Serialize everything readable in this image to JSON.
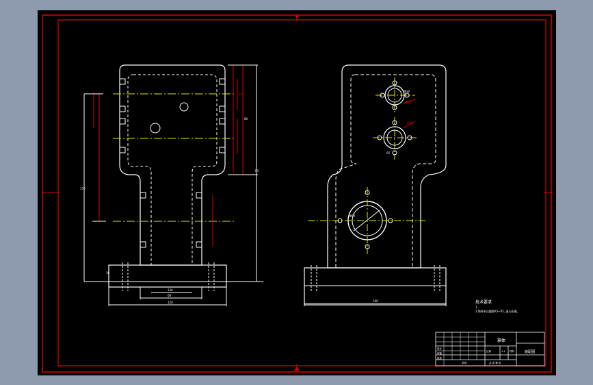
{
  "drawing": {
    "background": "#000000",
    "frame_color": "#e00000",
    "outline_color": "#ffffff",
    "centerline_color": "#e6e600",
    "dimension_color": "#e00000",
    "leader_color": "#00c8c8"
  },
  "notes": {
    "title": "技术要求",
    "line1": "1.",
    "line2": "2.铸件未注圆角R3~R5, 退火处理。"
  },
  "title_block": {
    "part_name": "箱体",
    "drawing_no": "装配图",
    "scale_label": "比例",
    "scale_value": "1:1",
    "material_label": "材料",
    "designer_label": "设计",
    "checker_label": "审核",
    "approval_label": "批准",
    "sheet_label": "共 张 第 张",
    "school_label": "学院"
  },
  "left_view": {
    "dim_texts": [
      "80",
      "40",
      "170",
      "130",
      "30",
      "60",
      "120",
      "R5"
    ]
  },
  "right_view": {
    "dim_texts": [
      "Φ30",
      "Φ26",
      "Φ40",
      "Φ52",
      "R5",
      "100"
    ]
  }
}
